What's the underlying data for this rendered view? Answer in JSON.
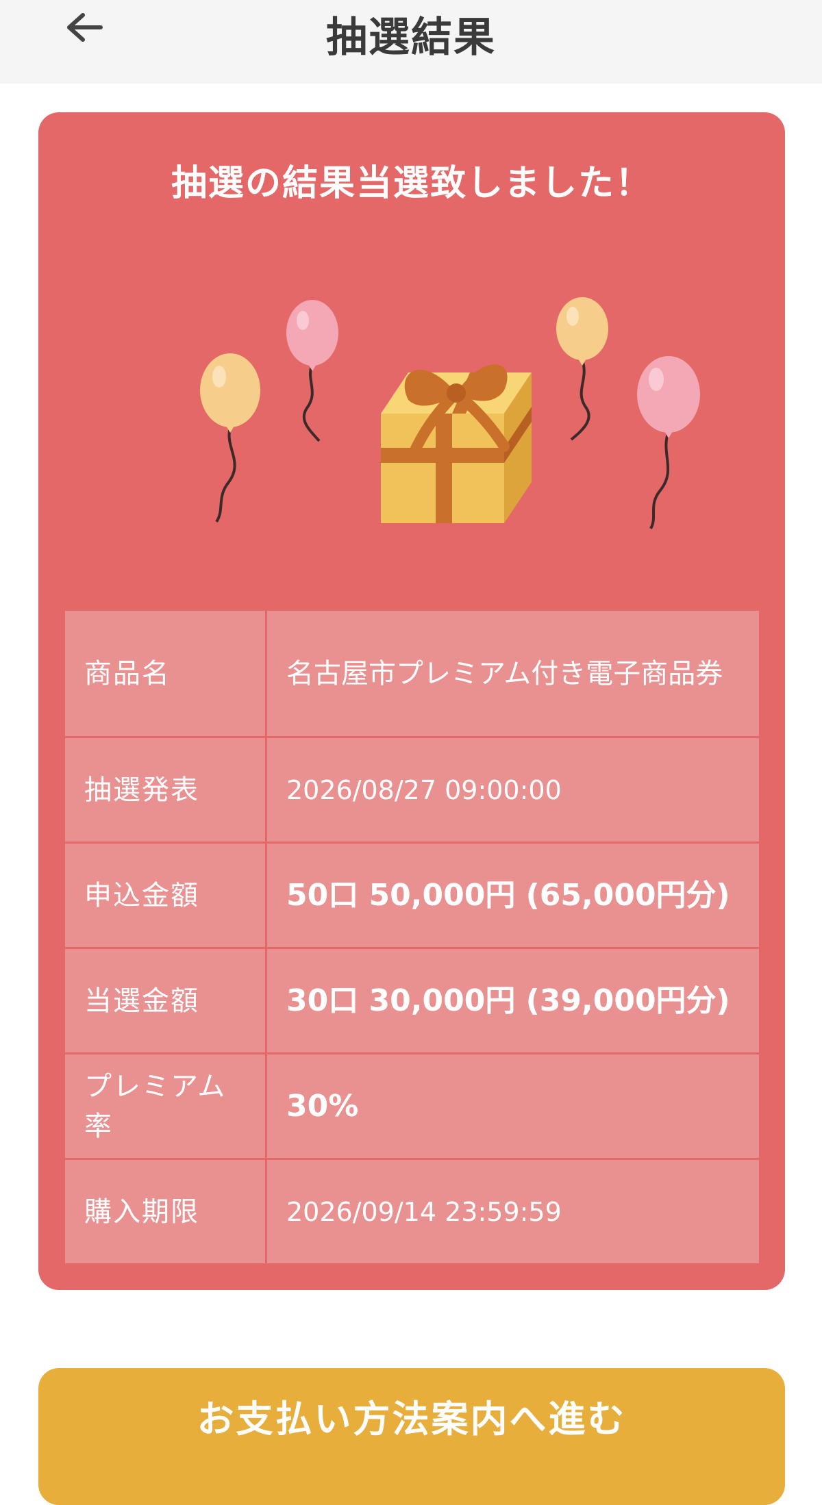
{
  "header": {
    "title": "抽選結果",
    "back_icon": "arrow-left-icon"
  },
  "result": {
    "heading": "抽選の結果当選致しました！",
    "illustration_icons": [
      "gift-box-icon",
      "balloon-icon"
    ],
    "colors": {
      "card": "#e46867",
      "table_cell": "#e99191",
      "button": "#e8ae3c",
      "header_bg": "#f5f5f5"
    },
    "rows": [
      {
        "label": "商品名",
        "value": "名古屋市プレミアム付き電子商品券"
      },
      {
        "label": "抽選発表",
        "value": "2026/08/27 09:00:00"
      },
      {
        "label": "申込金額",
        "value": "50口 50,000円 (65,000円分)"
      },
      {
        "label": "当選金額",
        "value": "30口 30,000円 (39,000円分)"
      },
      {
        "label": "プレミアム率",
        "value": "30%"
      },
      {
        "label": "購入期限",
        "value": "2026/09/14 23:59:59"
      }
    ]
  },
  "actions": {
    "proceed_label": "お支払い方法案内へ進む"
  }
}
